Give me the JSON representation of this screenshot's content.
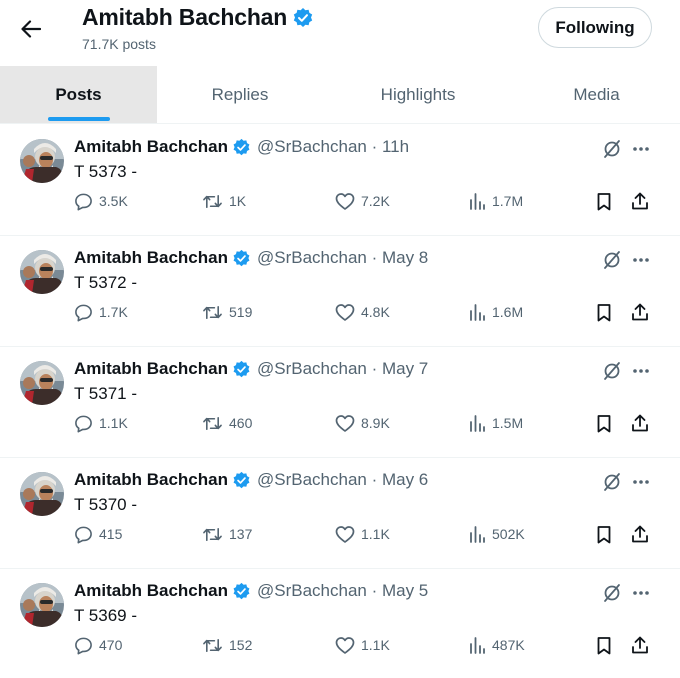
{
  "header": {
    "name": "Amitabh Bachchan",
    "post_count": "71.7K posts",
    "follow_label": "Following"
  },
  "tabs": [
    {
      "label": "Posts",
      "active": true
    },
    {
      "label": "Replies",
      "active": false
    },
    {
      "label": "Highlights",
      "active": false
    },
    {
      "label": "Media",
      "active": false
    }
  ],
  "colors": {
    "verified": "#1d9bf0",
    "accent": "#1d9bf0",
    "secondary_text": "#536471"
  },
  "posts": [
    {
      "author": "Amitabh Bachchan",
      "meta": "@SrBachchan · 11h",
      "text": "T 5373 -",
      "replies": "3.5K",
      "reposts": "1K",
      "likes": "7.2K",
      "views": "1.7M"
    },
    {
      "author": "Amitabh Bachchan",
      "meta": "@SrBachchan · May 8",
      "text": "T 5372 -",
      "replies": "1.7K",
      "reposts": "519",
      "likes": "4.8K",
      "views": "1.6M"
    },
    {
      "author": "Amitabh Bachchan",
      "meta": "@SrBachchan · May 7",
      "text": "T 5371 -",
      "replies": "1.1K",
      "reposts": "460",
      "likes": "8.9K",
      "views": "1.5M"
    },
    {
      "author": "Amitabh Bachchan",
      "meta": "@SrBachchan · May 6",
      "text": "T 5370 -",
      "replies": "415",
      "reposts": "137",
      "likes": "1.1K",
      "views": "502K"
    },
    {
      "author": "Amitabh Bachchan",
      "meta": "@SrBachchan · May 5",
      "text": "T 5369 -",
      "replies": "470",
      "reposts": "152",
      "likes": "1.1K",
      "views": "487K"
    }
  ]
}
